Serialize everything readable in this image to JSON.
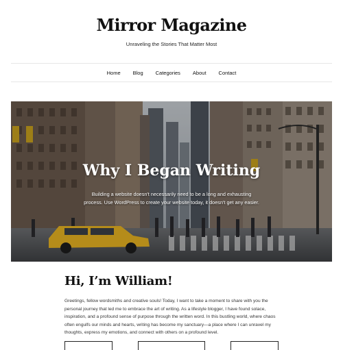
{
  "site": {
    "title": "Mirror Magazine",
    "tagline": "Unraveling the Stories That Matter Most"
  },
  "nav": {
    "items": [
      "Home",
      "Blog",
      "Categories",
      "About",
      "Contact"
    ]
  },
  "hero": {
    "title": "Why I Began Writing",
    "text": "Building a website doesn't necessarily need to be a long and exhausting process. Use WordPress to create your website today, it doesn't get any easier."
  },
  "intro": {
    "title": "Hi, I’m William!",
    "text": "Greetings, fellow wordsmiths and creative souls! Today, I want to take a moment to share with you the personal journey that led me to embrace the art of writing. As a lifestyle blogger, I have found solace, inspiration, and a profound sense of purpose through the written word. In this bustling world, where chaos often engulfs our minds and hearts, writing has become my sanctuary—a place where I can unravel my thoughts, express my emotions, and connect with others on a profound level."
  },
  "colors": {
    "text": "#111111",
    "taxi": "#e8b422",
    "rule": "#e6e6e6"
  }
}
